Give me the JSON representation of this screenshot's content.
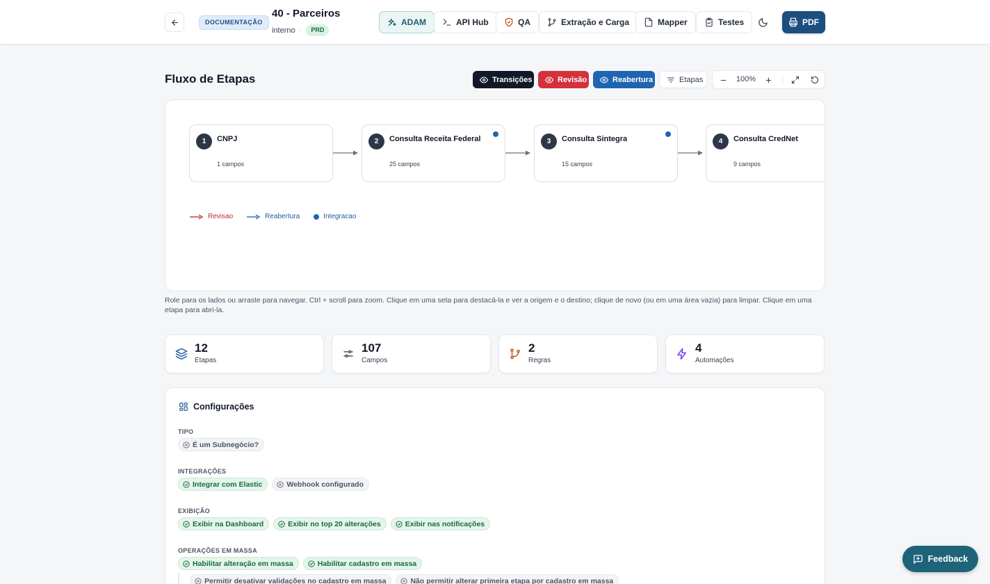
{
  "header": {
    "doc_badge": "DOCUMENTAÇÃO",
    "title": "40 - Parceiros",
    "subtitle": "interno",
    "separator": "·",
    "env_badge": "PRD",
    "nav": [
      {
        "label": "ADAM",
        "icon": "sparkle-icon",
        "active": true
      },
      {
        "label": "API Hub",
        "icon": "terminal-icon",
        "active": false
      },
      {
        "label": "QA",
        "icon": "shield-check-icon",
        "active": false
      },
      {
        "label": "Extração e Carga",
        "icon": "git-branch-icon",
        "active": false
      },
      {
        "label": "Mapper",
        "icon": "file-icon",
        "active": false
      },
      {
        "label": "Testes",
        "icon": "clipboard-check-icon",
        "active": false
      }
    ],
    "pdf_label": "PDF"
  },
  "flow": {
    "title": "Fluxo de Etapas",
    "toggles": {
      "transicoes": "Transições",
      "revisao": "Revisão",
      "reabertura": "Reabertura",
      "etapas": "Etapas"
    },
    "zoom": "100%",
    "stages": [
      {
        "num": "1",
        "name": "CNPJ",
        "count": "1 campos",
        "integration": false
      },
      {
        "num": "2",
        "name": "Consulta Receita Federal",
        "count": "25 campos",
        "integration": true
      },
      {
        "num": "3",
        "name": "Consulta Sintegra",
        "count": "15 campos",
        "integration": true
      },
      {
        "num": "4",
        "name": "Consulta CredNet",
        "count": "9 campos",
        "integration": false
      }
    ],
    "legend": {
      "revisao": "Revisao",
      "reabertura": "Reabertura",
      "integracao": "Integracao"
    },
    "help": "Role para os lados ou arraste para navegar. Ctrl + scroll para zoom. Clique em uma seta para destacá-la e ver a origem e o destino; clique de novo (ou em uma área vazia) para limpar. Clique em uma etapa para abri-la."
  },
  "stats": [
    {
      "value": "12",
      "label": "Etapas",
      "icon": "layers-icon",
      "color": "#1f5c9e"
    },
    {
      "value": "107",
      "label": "Campos",
      "icon": "sliders-icon",
      "color": "#4b5563"
    },
    {
      "value": "2",
      "label": "Regras",
      "icon": "git-branch-icon",
      "color": "#c2571a"
    },
    {
      "value": "4",
      "label": "Automações",
      "icon": "zap-icon",
      "color": "#7c3aed"
    }
  ],
  "config": {
    "title": "Configurações",
    "groups": {
      "tipo": {
        "label": "TIPO",
        "items": [
          {
            "text": "É um Subnegócio?",
            "on": false
          }
        ]
      },
      "integracoes": {
        "label": "INTEGRAÇÕES",
        "items": [
          {
            "text": "Integrar com Elastic",
            "on": true
          },
          {
            "text": "Webhook configurado",
            "on": false
          }
        ]
      },
      "exibicao": {
        "label": "EXIBIÇÃO",
        "items": [
          {
            "text": "Exibir na Dashboard",
            "on": true
          },
          {
            "text": "Exibir no top 20 alterações",
            "on": true
          },
          {
            "text": "Exibir nas notificações",
            "on": true
          }
        ]
      },
      "massa": {
        "label": "OPERAÇÕES EM MASSA",
        "items": [
          {
            "text": "Habilitar alteração em massa",
            "on": true
          },
          {
            "text": "Habilitar cadastro em massa",
            "on": true
          }
        ],
        "sub": [
          {
            "text": "Permitir desativar validações no cadastro em massa",
            "on": false
          },
          {
            "text": "Não permitir alterar primeira etapa por cadastro em massa",
            "on": false
          }
        ]
      }
    }
  },
  "feedback_label": "Feedback"
}
